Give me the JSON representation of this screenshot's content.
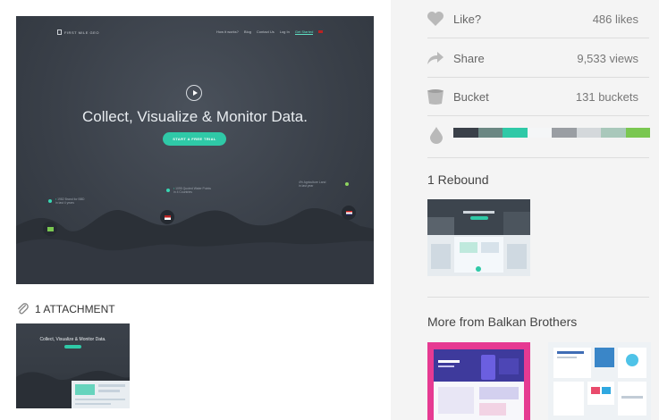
{
  "shot": {
    "logo_text": "FIRST MILE GEO",
    "nav": [
      "How it works?",
      "Blog",
      "Contact Us",
      "Log In",
      "Get Started"
    ],
    "headline": "Collect, Visualize & Monitor Data.",
    "cta_label": "START A FREE TRIAL"
  },
  "attachments": {
    "title": "1 ATTACHMENT",
    "thumb_headline": "Collect, Visualize & Monitor Data."
  },
  "stats": [
    {
      "label": "Like?",
      "count": "486 likes",
      "icon": "heart-icon"
    },
    {
      "label": "Share",
      "count": "9,533 views",
      "icon": "share-arrow-icon"
    },
    {
      "label": "Bucket",
      "count": "131 buckets",
      "icon": "bucket-icon"
    }
  ],
  "palette": [
    "#3a4049",
    "#6b8783",
    "#2fc9a7",
    "#f4f6f7",
    "#9a9ea3",
    "#d4d8db",
    "#a9c8bb",
    "#7ac751"
  ],
  "rebounds": {
    "title": "1 Rebound"
  },
  "more": {
    "title": "More from Balkan Brothers"
  },
  "colors": {
    "accent": "#2fc9a7",
    "sidebar_bg": "#f4f4f4"
  }
}
